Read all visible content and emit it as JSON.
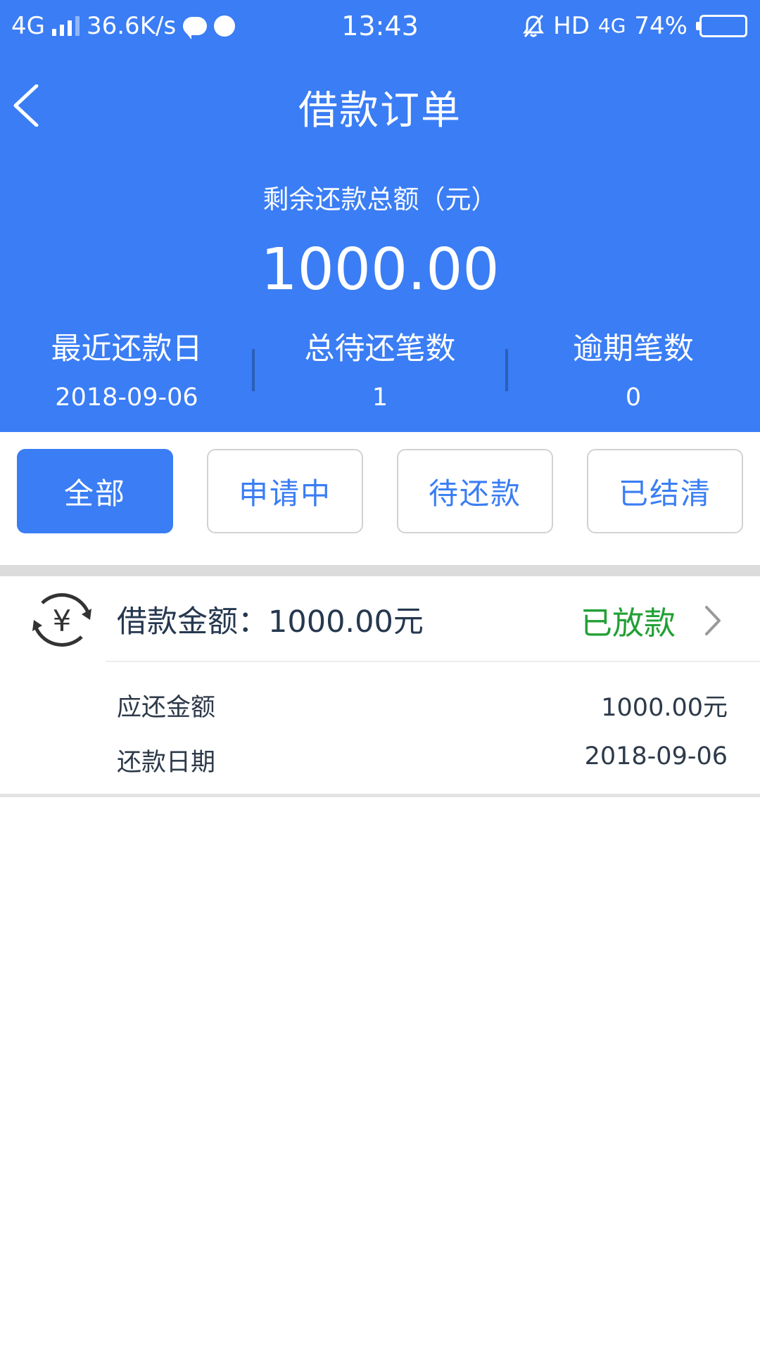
{
  "status_bar": {
    "network": "4G",
    "speed": "36.6K/s",
    "time": "13:43",
    "hd": "HD",
    "network_right": "4G",
    "battery": "74%",
    "battery_level": 0.74
  },
  "nav": {
    "title": "借款订单",
    "back_icon": "chevron-left-icon"
  },
  "summary": {
    "remain_label": "剩余还款总额（元）",
    "remain_amount": "1000.00",
    "stats": [
      {
        "label": "最近还款日",
        "value": "2018-09-06"
      },
      {
        "label": "总待还笔数",
        "value": "1"
      },
      {
        "label": "逾期笔数",
        "value": "0"
      }
    ]
  },
  "tabs": [
    {
      "label": "全部",
      "active": true
    },
    {
      "label": "申请中",
      "active": false
    },
    {
      "label": "待还款",
      "active": false
    },
    {
      "label": "已结清",
      "active": false
    }
  ],
  "order": {
    "icon": "yuan-refresh-icon",
    "title": "借款金额：1000.00元",
    "status": "已放款",
    "rows": [
      {
        "key": "应还金额",
        "value": "1000.00元"
      },
      {
        "key": "还款日期",
        "value": "2018-09-06"
      }
    ]
  },
  "colors": {
    "primary": "#3a7df5",
    "success": "#22a036",
    "text": "#26384f"
  }
}
